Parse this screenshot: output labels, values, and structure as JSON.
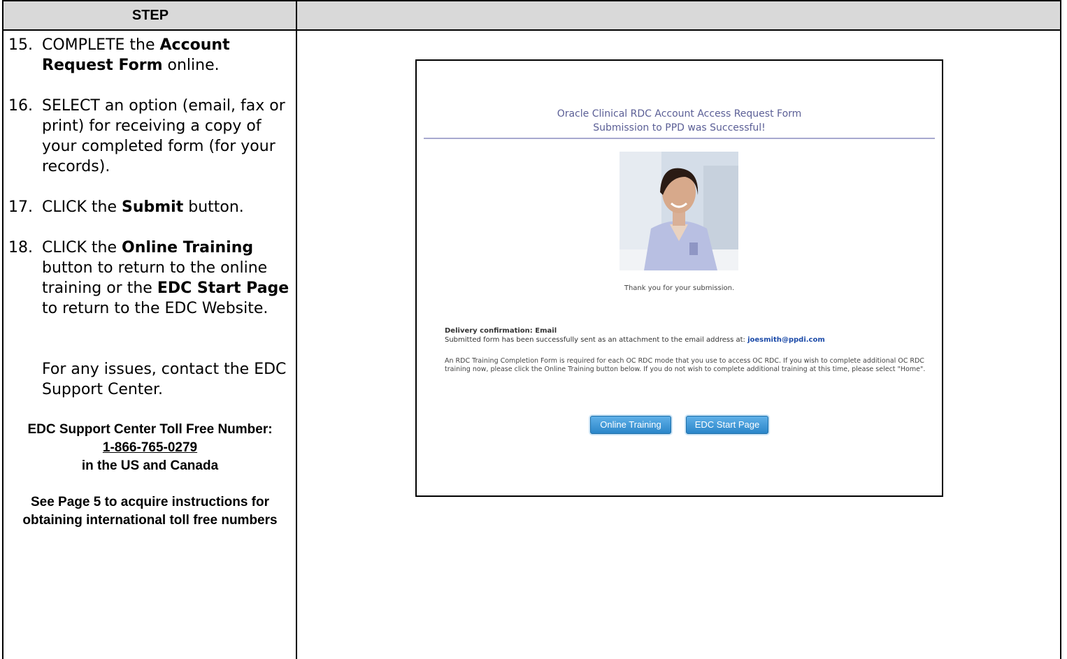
{
  "table": {
    "header_step": "STEP"
  },
  "steps": [
    {
      "num": "15.",
      "parts": [
        "COMPLETE the ",
        "Account Request Form",
        " online."
      ]
    },
    {
      "num": "16.",
      "text": "SELECT an option (email, fax or print) for receiving a copy of your completed form (for your records)."
    },
    {
      "num": "17.",
      "parts": [
        "CLICK the ",
        "Submit",
        " button."
      ]
    },
    {
      "num": "18.",
      "parts": [
        "CLICK the ",
        "Online Training",
        " button to return to the online training or the ",
        "EDC Start Page",
        " to return to the EDC Website."
      ]
    }
  ],
  "contact": {
    "text": "For any issues, contact the EDC Support Center.",
    "toll_free_line1": "EDC Support Center Toll Free Number:",
    "phone": "1-866-765-0279",
    "region": "in the US and Canada",
    "see_page": "See Page 5 to acquire instructions for obtaining international toll free numbers"
  },
  "screenshot": {
    "title_line1": "Oracle Clinical RDC Account Access Request Form",
    "title_line2": "Submission to PPD was Successful!",
    "thanks": "Thank you for your submission.",
    "delivery_label": "Delivery confirmation: Email",
    "delivery_text": "Submitted form has been successfully sent as an attachment to the email address at: ",
    "email": "joesmith@ppdi.com",
    "rdc_note": "An RDC Training Completion Form is required for each OC RDC mode that you use to access OC RDC. If you wish to complete additional OC RDC training now, please click the Online Training button below. If you do not wish to complete additional training at this time, please select \"Home\".",
    "btn_training": "Online Training",
    "btn_start": "EDC Start Page"
  },
  "colors": {
    "header_bg": "#d9d9d9",
    "title_color": "#5b5f96",
    "button_blue": "#2b86c9",
    "email_color": "#1b4aa8"
  }
}
